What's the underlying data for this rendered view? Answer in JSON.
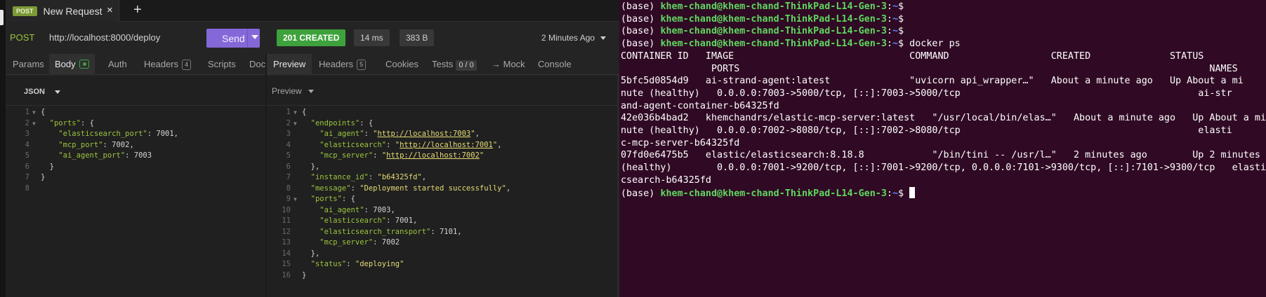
{
  "app": {
    "tab": {
      "method": "POST",
      "title": "New Request",
      "close": "×",
      "add": "+"
    },
    "url": {
      "method": "POST",
      "value": "http://localhost:8000/deploy",
      "send_label": "Send"
    },
    "response": {
      "status": "201 CREATED",
      "time": "14 ms",
      "size": "383 B",
      "ago": "2 Minutes Ago"
    },
    "request_tabs": [
      {
        "label": "Params"
      },
      {
        "label": "Body"
      },
      {
        "label": "Auth"
      },
      {
        "label": "Headers",
        "count": "4"
      },
      {
        "label": "Scripts"
      },
      {
        "label": "Doc"
      }
    ],
    "response_tabs": [
      {
        "label": "Preview"
      },
      {
        "label": "Headers",
        "count": "5"
      },
      {
        "label": "Cookies"
      },
      {
        "label": "Tests",
        "count": "0 / 0"
      },
      {
        "label": "→ Mock"
      },
      {
        "label": "Console"
      }
    ],
    "body_type": "JSON",
    "preview_mode": "Preview",
    "request_body": [
      "{",
      "  \"ports\": {",
      "    \"elasticsearch_port\": 7001,",
      "    \"mcp_port\": 7002,",
      "    \"ai_agent_port\": 7003",
      "  }",
      "}",
      ""
    ],
    "response_body": [
      "{",
      "  \"endpoints\": {",
      "    \"ai_agent\": \"http://localhost:7003\",",
      "    \"elasticsearch\": \"http://localhost:7001\",",
      "    \"mcp_server\": \"http://localhost:7002\"",
      "  },",
      "  \"instance_id\": \"b64325fd\",",
      "  \"message\": \"Deployment started successfully\",",
      "  \"ports\": {",
      "    \"ai_agent\": 7003,",
      "    \"elasticsearch\": 7001,",
      "    \"elasticsearch_transport\": 7101,",
      "    \"mcp_server\": 7002",
      "  },",
      "  \"status\": \"deploying\"",
      "}"
    ]
  },
  "terminal": {
    "prompt_env": "(base) ",
    "prompt_user": "khem-chand@khem-chand-ThinkPad-L14-Gen-3",
    "prompt_sep": ":",
    "prompt_path": "~",
    "prompt_end": "$ ",
    "command": "docker ps",
    "output": [
      "CONTAINER ID   IMAGE                               COMMAND                  CREATED              STATUS",
      "                PORTS                                                                                   NAMES",
      "5bfc5d0854d9   ai-strand-agent:latest              \"uvicorn api_wrapper…\"   About a minute ago   Up About a mi",
      "nute (healthy)   0.0.0.0:7003->5000/tcp, [::]:7003->5000/tcp                                          ai-str",
      "and-agent-container-b64325fd",
      "42e036b4bad2   khemchandrs/elastic-mcp-server:latest   \"/usr/local/bin/elas…\"   About a minute ago   Up About a mi",
      "nute (healthy)   0.0.0.0:7002->8080/tcp, [::]:7002->8080/tcp                                          elasti",
      "c-mcp-server-b64325fd",
      "07fd0e6475b5   elastic/elasticsearch:8.18.8            \"/bin/tini -- /usr/l…\"   2 minutes ago        Up 2 minutes",
      "(healthy)        0.0.0.0:7001->9200/tcp, [::]:7001->9200/tcp, 0.0.0.0:7101->9300/tcp, [::]:7101->9300/tcp   elasti",
      "csearch-b64325fd"
    ]
  }
}
